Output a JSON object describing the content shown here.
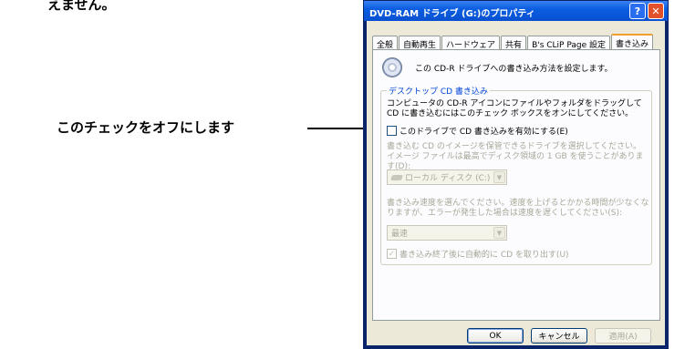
{
  "page": {
    "top_caption": "えません。",
    "callout": "このチェックをオフにします"
  },
  "dialog": {
    "title": "DVD-RAM ドライブ (G:)のプロパティ",
    "tabs": [
      "全般",
      "自動再生",
      "ハードウェア",
      "共有",
      "B's CLiP Page 設定",
      "書き込み"
    ],
    "active_tab_index": 5,
    "header_text": "この CD-R ドライブへの書き込み方法を設定します。",
    "group_title": "デスクトップ CD 書き込み",
    "group_desc": "コンピュータの CD-R アイコンにファイルやフォルダをドラッグして CD に書き込むにはこのチェック ボックスをオンにしてください。",
    "enable_checkbox": {
      "label": "このドライブで CD 書き込みを有効にする(E)",
      "checked": false
    },
    "image_desc": "書き込む CD のイメージを保管できるドライブを選択してください。イメージ ファイルは最高でディスク領域の 1 GB を使うことがあります(D):",
    "drive_combo": {
      "value": "ローカル ディスク (C:)"
    },
    "speed_desc": "書き込み速度を選んでください。速度を上げるとかかる時間が少なくなりますが、エラーが発生した場合は速度を遅くしてください(S):",
    "speed_combo": {
      "value": "最速"
    },
    "eject_checkbox": {
      "label": "書き込み終了後に自動的に CD を取り出す(U)",
      "checked": true
    },
    "buttons": {
      "ok": "OK",
      "cancel": "キャンセル",
      "apply": "適用(A)"
    }
  },
  "colors": {
    "titlebar": "#0a5ee0",
    "dialog_face": "#ece9d8",
    "group_title": "#0046d5",
    "disabled_text": "#a8a89a"
  }
}
